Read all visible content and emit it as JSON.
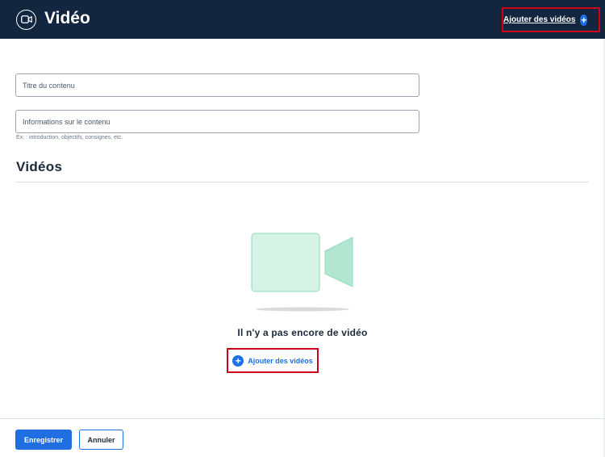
{
  "header": {
    "title": "Vidéo",
    "icon": "video-camera-icon",
    "add_videos_label": "Ajouter des vidéos",
    "background": "#132640"
  },
  "form": {
    "title_placeholder": "Titre du contenu",
    "info_placeholder": "Informations sur le contenu",
    "info_hint": "Ex. : introduction, objectifs, consignes, etc."
  },
  "videos_section": {
    "heading": "Vidéos",
    "empty_message": "Il n'y a pas encore de vidéo",
    "add_videos_label": "Ajouter des vidéos",
    "illustration_icon": "video-camera-illustration"
  },
  "footer": {
    "save_label": "Enregistrer",
    "cancel_label": "Annuler"
  },
  "colors": {
    "accent": "#1f6fe0",
    "highlight": "#d0021b",
    "illustration": "#b3e6d0"
  }
}
